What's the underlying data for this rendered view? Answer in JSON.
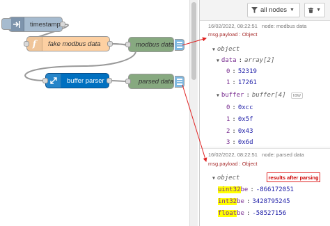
{
  "canvas": {
    "nodes": {
      "timestamp": "timestamp",
      "fake_modbus": "fake modbus data",
      "modbus_data": "modbus data",
      "buffer_parser": "buffer parser",
      "parsed_data": "parsed data"
    }
  },
  "sidebar": {
    "filter_label": "all nodes",
    "messages": [
      {
        "datetime": "16/02/2022, 08:22:51",
        "node": "node: modbus data",
        "topic": "msg.payload : Object",
        "root": "object",
        "data_key": "data",
        "data_type": "array[2]",
        "data_items": [
          {
            "index": "0",
            "value": "52319"
          },
          {
            "index": "1",
            "value": "17261"
          }
        ],
        "buffer_key": "buffer",
        "buffer_type": "buffer[4]",
        "raw_label": "raw",
        "buffer_items": [
          {
            "index": "0",
            "value": "0xcc"
          },
          {
            "index": "1",
            "value": "0x5f"
          },
          {
            "index": "2",
            "value": "0x43"
          },
          {
            "index": "3",
            "value": "0x6d"
          }
        ]
      },
      {
        "datetime": "16/02/2022, 08:22:51",
        "node": "node: parsed data",
        "topic": "msg.payload : Object",
        "root": "object",
        "props": [
          {
            "hl": "uint32",
            "rest": "be",
            "value": "-866172051"
          },
          {
            "hl": "int32",
            "rest": "be",
            "value": "3428795245"
          },
          {
            "hl": "float",
            "rest": "be",
            "value": "-58527156"
          }
        ]
      }
    ],
    "annotation": "results after parsing"
  },
  "colors": {
    "inject": "#a6bbcf",
    "function": "#fdd0a2",
    "debug": "#87a980",
    "buffer_parser": "#0070c0",
    "annotation": "#e02020",
    "highlight": "#ffff00"
  }
}
